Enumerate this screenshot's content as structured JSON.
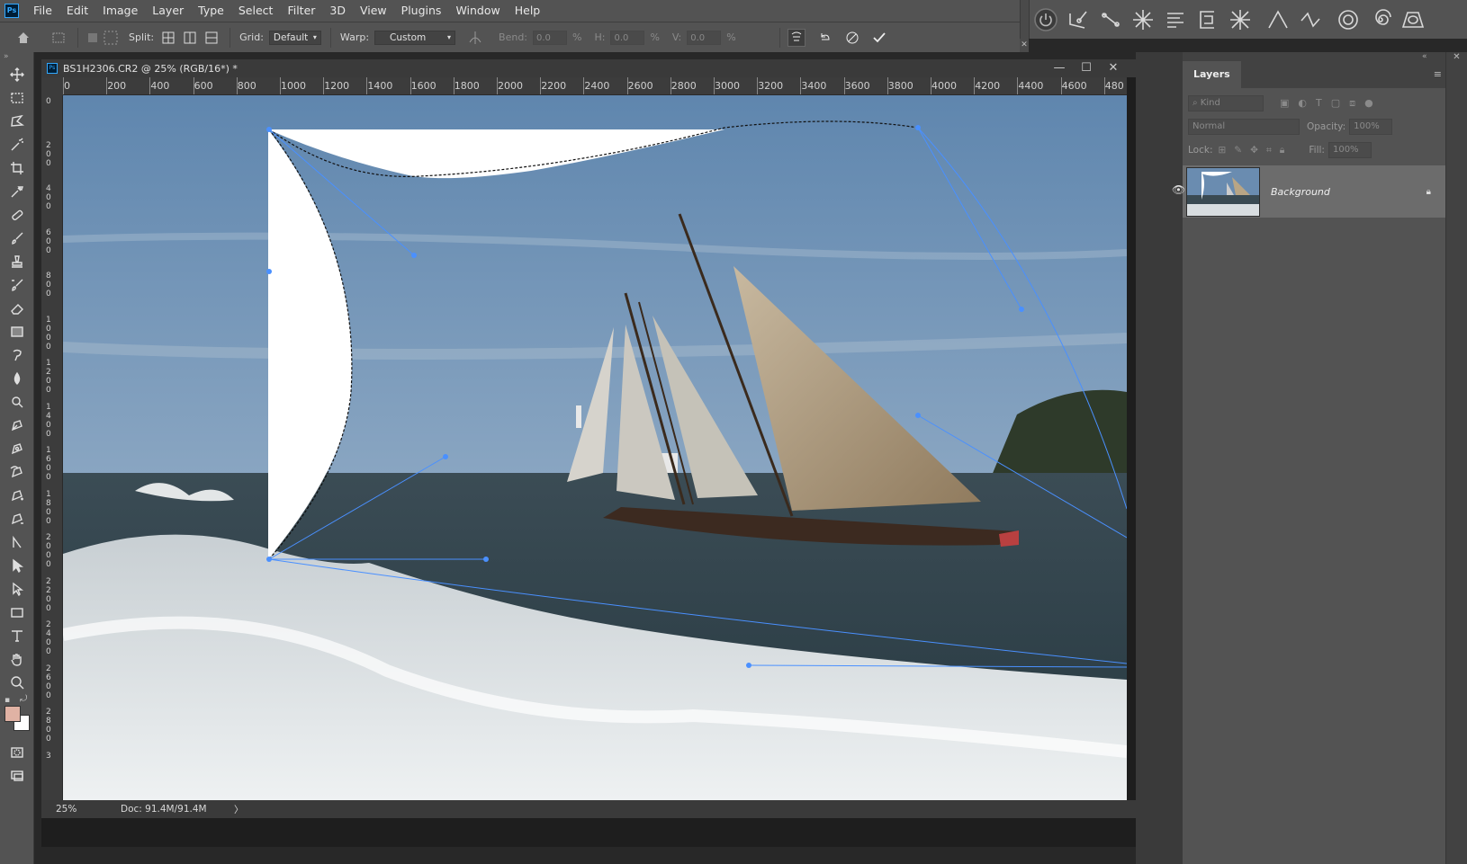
{
  "app": {
    "logo_text": "Ps"
  },
  "menubar": {
    "items": [
      "File",
      "Edit",
      "Image",
      "Layer",
      "Type",
      "Select",
      "Filter",
      "3D",
      "View",
      "Plugins",
      "Window",
      "Help"
    ]
  },
  "options": {
    "split_label": "Split:",
    "grid_label": "Grid:",
    "grid_value": "Default",
    "warp_label": "Warp:",
    "warp_value": "Custom",
    "bend_label": "Bend:",
    "bend_value": "0.0",
    "h_label": "H:",
    "h_value": "0.0",
    "v_label": "V:",
    "v_value": "0.0",
    "percent": "%"
  },
  "warp_tools": [
    "power-icon",
    "curve-pen-icon",
    "path-icon",
    "starburst-icon",
    "align-lines-icon",
    "bracket-icon",
    "vertex-icon",
    "arrow-a-icon",
    "wave-icon",
    "circle-icon",
    "spiral-icon",
    "trapezoid-icon"
  ],
  "document": {
    "title": "BS1H2306.CR2 @ 25% (RGB/16*) *",
    "ruler_h": [
      "0",
      "200",
      "400",
      "600",
      "800",
      "1000",
      "1200",
      "1400",
      "1600",
      "1800",
      "2000",
      "2200",
      "2400",
      "2600",
      "2800",
      "3000",
      "3200",
      "3400",
      "3600",
      "3800",
      "4000",
      "4200",
      "4400",
      "4600",
      "480"
    ],
    "ruler_v": [
      "0",
      "2\n0\n0",
      "4\n0\n0",
      "6\n0\n0",
      "8\n0\n0",
      "1\n0\n0\n0",
      "1\n2\n0\n0",
      "1\n4\n0\n0",
      "1\n6\n0\n0",
      "1\n8\n0\n0",
      "2\n0\n0\n0",
      "2\n2\n0\n0",
      "2\n4\n0\n0",
      "2\n6\n0\n0",
      "2\n8\n0\n0",
      "3"
    ]
  },
  "status": {
    "zoom": "25%",
    "doc": "Doc: 91.4M/91.4M",
    "arrow": "〉"
  },
  "layers_panel": {
    "tab": "Layers",
    "kind_placeholder": "Kind",
    "blend_mode": "Normal",
    "opacity_label": "Opacity:",
    "opacity_value": "100%",
    "lock_label": "Lock:",
    "fill_label": "Fill:",
    "fill_value": "100%",
    "layers": [
      {
        "name": "Background",
        "visible": true,
        "locked": true
      }
    ]
  },
  "colors": {
    "foreground": "#e0b2a4",
    "background": "#ffffff",
    "accent": "#4a90ff"
  }
}
